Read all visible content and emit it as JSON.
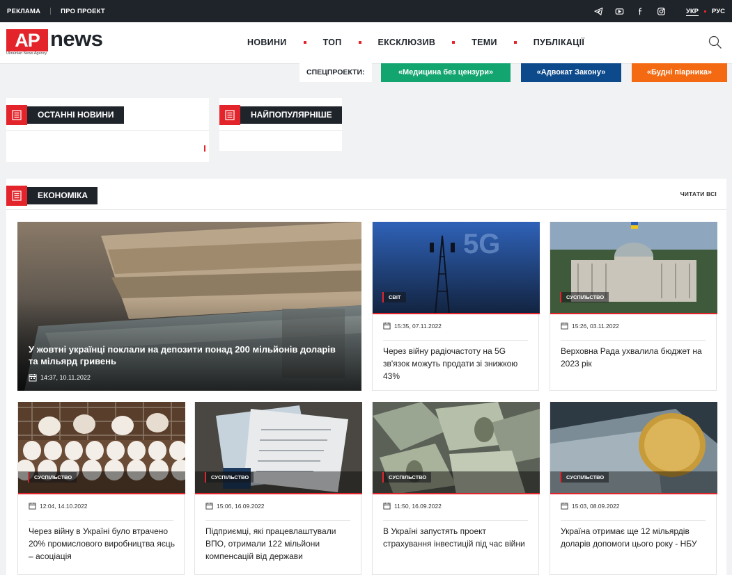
{
  "topbar": {
    "links": [
      "РЕКЛАМА",
      "ПРО ПРОЕКТ"
    ],
    "langs": [
      "УКР",
      "РУС"
    ]
  },
  "logo": {
    "mark": "AP",
    "word": "news",
    "tagline": "Ukrainian News Agency"
  },
  "nav": [
    "НОВИНИ",
    "ТОП",
    "ЕКСКЛЮЗИВ",
    "ТЕМИ",
    "ПУБЛІКАЦІЇ"
  ],
  "specials": {
    "label": "СПЕЦПРОЕКТИ:",
    "items": [
      {
        "label": "«Медицина без цензури»",
        "color": "#12a56f"
      },
      {
        "label": "«Адвокат Закону»",
        "color": "#0c4a8c"
      },
      {
        "label": "«Будні піарника»",
        "color": "#f36a12"
      }
    ]
  },
  "widgets": {
    "latest": "ОСТАННІ НОВИНИ",
    "popular": "НАЙПОПУЛЯРНІШЕ"
  },
  "section": {
    "title": "ЕКОНОМІКА",
    "read_all": "ЧИТАТИ ВСІ",
    "featured": {
      "title": "У жовтні українці поклали на депозити понад 200 мільйонів доларів та мільярд гривень",
      "date": "14:37, 10.11.2022"
    },
    "cards": [
      {
        "category": "СВІТ",
        "date": "15:35, 07.11.2022",
        "title": "Через війну радіочастоту на 5G зв'язок можуть продати зі знижкою 43%"
      },
      {
        "category": "СУСПІЛЬСТВО",
        "date": "15:26, 03.11.2022",
        "title": "Верховна Рада ухвалила бюджет на 2023 рік"
      },
      {
        "category": "СУСПІЛЬСТВО",
        "date": "12:04, 14.10.2022",
        "title": "Через війну в Україні було втрачено 20% промислового виробництва яєць – асоціація"
      },
      {
        "category": "СУСПІЛЬСТВО",
        "date": "15:06, 16.09.2022",
        "title": "Підприємці, які працевлаштували ВПО, отримали 122 мільйони компенсацій від держави"
      },
      {
        "category": "СУСПІЛЬСТВО",
        "date": "11:50, 16.09.2022",
        "title": "В Україні запустять проект страхування інвестицій під час війни"
      },
      {
        "category": "СУСПІЛЬСТВО",
        "date": "15:03, 08.09.2022",
        "title": "Україна отримає ще 12 мільярдів доларів допомоги цього року - НБУ"
      }
    ]
  },
  "colors": {
    "accent": "#e3252b",
    "dark": "#1f242b"
  }
}
